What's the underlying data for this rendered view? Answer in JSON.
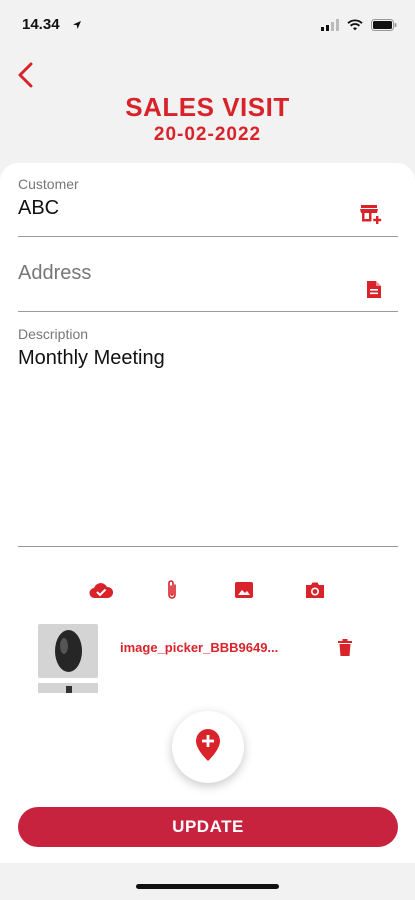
{
  "status_bar": {
    "time": "14.34",
    "icons": [
      "location-arrow-icon",
      "signal-icon",
      "wifi-icon",
      "battery-icon"
    ]
  },
  "header": {
    "title": "SALES VISIT",
    "date": "20-02-2022",
    "back_icon": "chevron-left-icon"
  },
  "form": {
    "customer": {
      "label": "Customer",
      "value": "ABC",
      "icon": "store-add-icon"
    },
    "address": {
      "placeholder": "Address",
      "icon": "document-icon"
    },
    "description": {
      "label": "Description",
      "value": "Monthly Meeting"
    }
  },
  "toolbar": {
    "icons": [
      "cloud-done-icon",
      "paperclip-icon",
      "image-icon",
      "camera-icon"
    ]
  },
  "attachments": [
    {
      "name": "image_picker_BBB9649...",
      "delete_icon": "trash-icon"
    }
  ],
  "fab": {
    "icon": "add-location-icon"
  },
  "actions": {
    "update_label": "UPDATE"
  },
  "colors": {
    "accent": "#d9232a",
    "button": "#c8233e",
    "background": "#f2f2f2",
    "card": "#ffffff"
  }
}
